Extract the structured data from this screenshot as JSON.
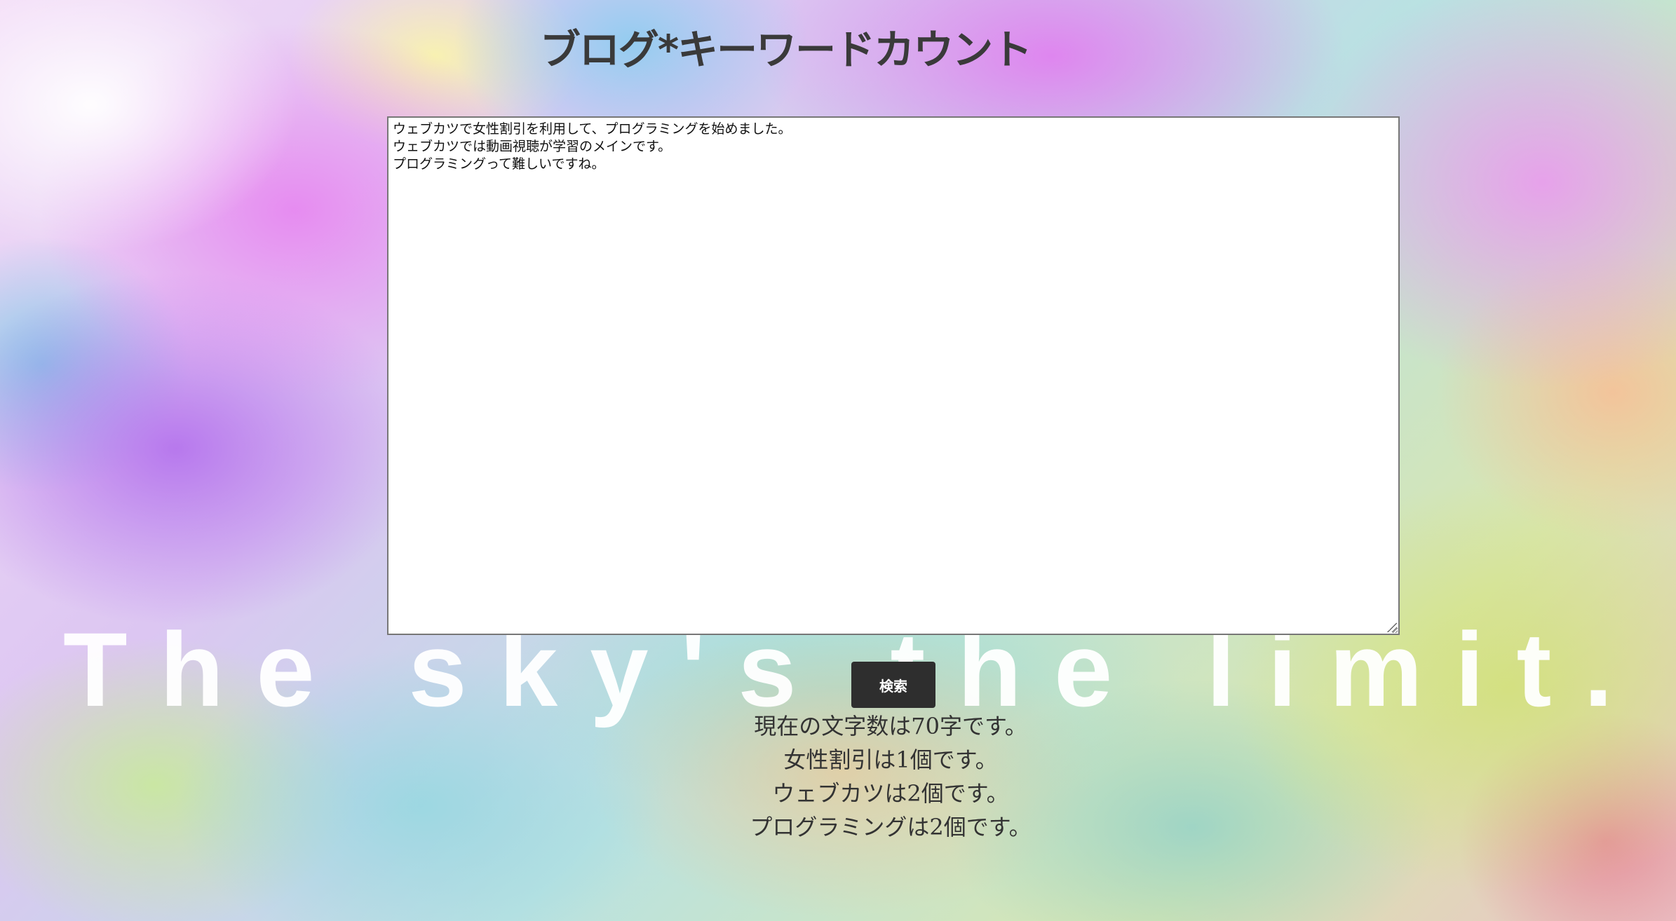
{
  "page": {
    "title": "ブログ*キーワードカウント",
    "background_slogan": "The sky's the limit."
  },
  "editor": {
    "value": "ウェブカツで女性割引を利用して、プログラミングを始めました。\nウェブカツでは動画視聴が学習のメインです。\nプログラミングって難しいですね。"
  },
  "search_button": {
    "label": "検索"
  },
  "results": [
    "現在の文字数は70字です。",
    "女性割引は1個です。",
    "ウェブカツは2個です。",
    "プログラミングは2個です。"
  ],
  "colors": {
    "title_text": "#3a3a3a",
    "button_bg": "#2e2e2e",
    "button_text": "#ffffff",
    "result_text": "#333333"
  }
}
